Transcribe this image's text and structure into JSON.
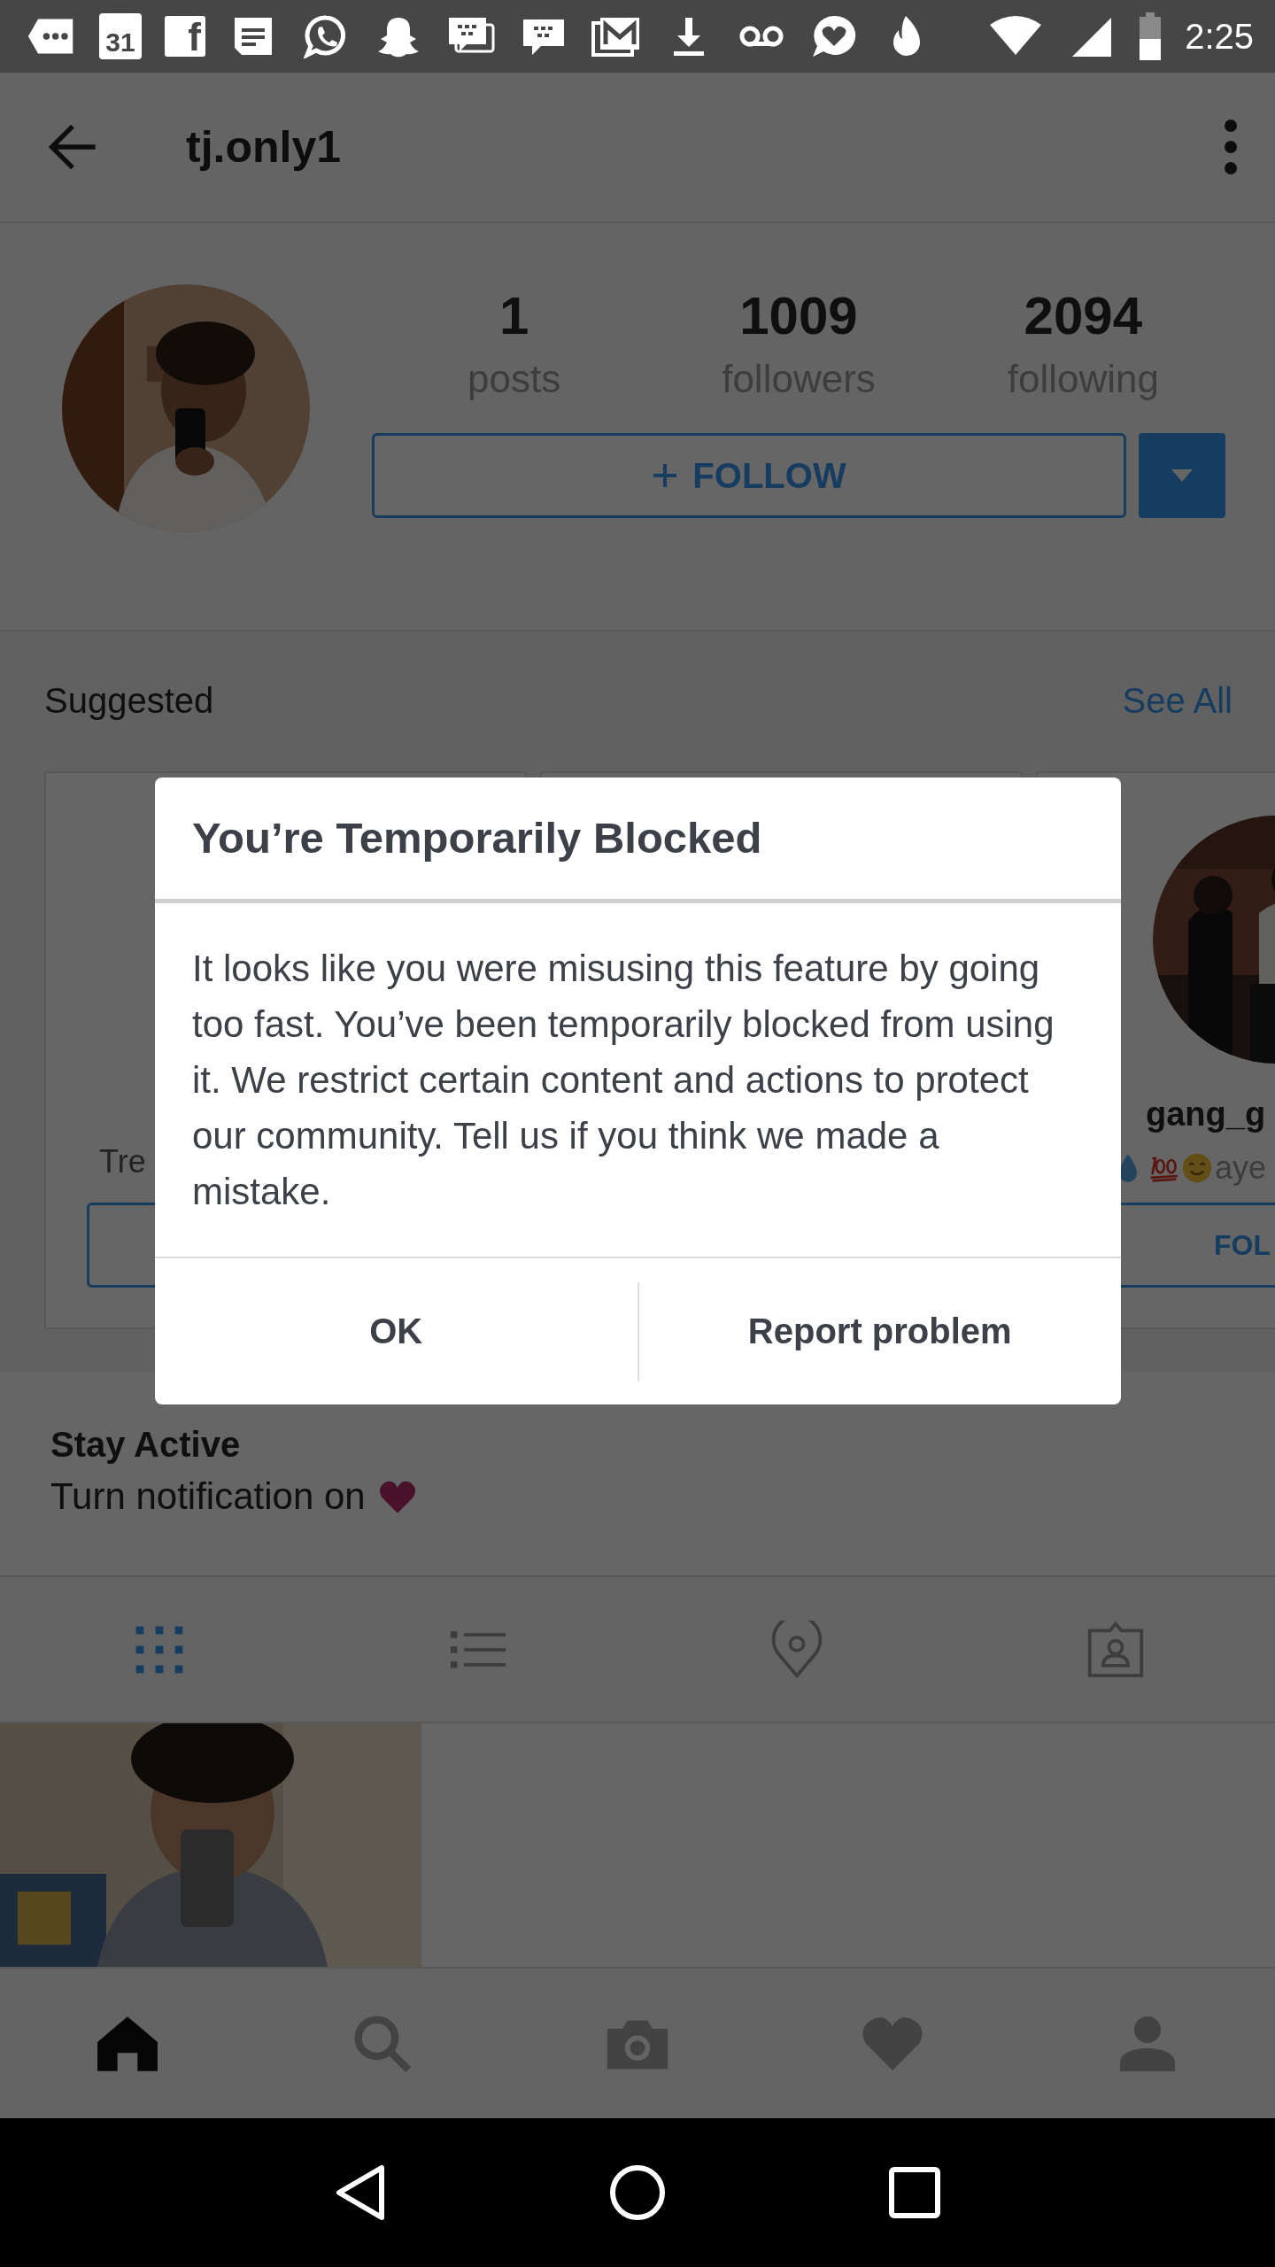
{
  "status_bar": {
    "notifications": [
      {
        "kind": "more"
      },
      {
        "kind": "calendar",
        "label": "31"
      },
      {
        "kind": "facebook",
        "label": "f"
      },
      {
        "kind": "document"
      },
      {
        "kind": "chat-circle"
      },
      {
        "kind": "ghost"
      },
      {
        "kind": "bubbles"
      },
      {
        "kind": "bubble"
      },
      {
        "kind": "mail"
      },
      {
        "kind": "download"
      },
      {
        "kind": "voicemail"
      },
      {
        "kind": "heart-bubble"
      },
      {
        "kind": "flame"
      }
    ],
    "time": "2:25"
  },
  "app_bar": {
    "title": "tj.only1"
  },
  "profile": {
    "stats": [
      {
        "value": "1",
        "label": "posts"
      },
      {
        "value": "1009",
        "label": "followers"
      },
      {
        "value": "2094",
        "label": "following"
      }
    ],
    "follow_button": {
      "label": "FOLLOW"
    }
  },
  "suggested": {
    "title": "Suggested",
    "see_all": "See All",
    "cards": [
      {
        "kind": "partial",
        "subtitle": "Tre"
      },
      {
        "kind": "empty"
      },
      {
        "kind": "profile",
        "name": "gang_g",
        "subtitle": "aye",
        "button": "FOL"
      }
    ]
  },
  "dialog": {
    "title": "You’re Temporarily Blocked",
    "message": "It looks like you were misusing this feature by going too fast. You’ve been temporarily blocked from using it. We restrict certain content and actions to protect our community. Tell us if you think we made a mistake.",
    "buttons": [
      {
        "label": "OK"
      },
      {
        "label": "Report problem"
      }
    ]
  },
  "stay_active": {
    "title": "Stay Active",
    "text": "Turn notification on"
  },
  "view_tabs": [
    {
      "kind": "grid",
      "selected": true
    },
    {
      "kind": "list",
      "selected": false
    },
    {
      "kind": "location",
      "selected": false
    },
    {
      "kind": "tagged",
      "selected": false
    }
  ],
  "bottom_nav": [
    {
      "kind": "home",
      "selected": true
    },
    {
      "kind": "search",
      "selected": false
    },
    {
      "kind": "camera",
      "selected": false
    },
    {
      "kind": "heart",
      "selected": false
    },
    {
      "kind": "profile",
      "selected": false
    }
  ]
}
